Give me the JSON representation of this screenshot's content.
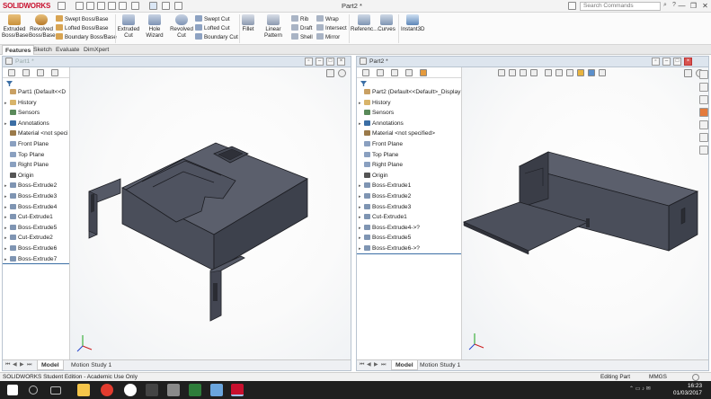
{
  "titlebar": {
    "logo": "SOLIDWORKS",
    "title": "Part2 *",
    "search_placeholder": "Search Commands",
    "search_icon": "search-icon",
    "window_buttons": [
      "—",
      "❐",
      "✕"
    ]
  },
  "ribbon": {
    "extruded_boss": "Extruded Boss/Base",
    "revolved_boss": "Revolved Boss/Base",
    "swept_boss": "Swept Boss/Base",
    "lofted_boss": "Lofted Boss/Base",
    "boundary_boss": "Boundary Boss/Base",
    "extruded_cut": "Extruded Cut",
    "hole_wizard": "Hole Wizard",
    "revolved_cut": "Revolved Cut",
    "swept_cut": "Swept Cut",
    "lofted_cut": "Lofted Cut",
    "boundary_cut": "Boundary Cut",
    "fillet": "Fillet",
    "linear_pattern": "Linear Pattern",
    "rib": "Rib",
    "draft": "Draft",
    "shell": "Shell",
    "wrap": "Wrap",
    "intersect": "Intersect",
    "mirror": "Mirror",
    "reference": "Referenc...",
    "curves": "Curves",
    "instant3d": "Instant3D"
  },
  "command_tabs": [
    "Features",
    "Sketch",
    "Evaluate",
    "DimXpert"
  ],
  "win1": {
    "title": "Part1 *",
    "tree": [
      {
        "label": "Part1  (Default<<D",
        "arrow": "",
        "icon": "part"
      },
      {
        "label": "History",
        "arrow": "▸",
        "icon": "folder"
      },
      {
        "label": "Sensors",
        "arrow": "",
        "icon": "sensor"
      },
      {
        "label": "Annotations",
        "arrow": "▸",
        "icon": "annotation"
      },
      {
        "label": "Material <not speci",
        "arrow": "",
        "icon": "material"
      },
      {
        "label": "Front Plane",
        "arrow": "",
        "icon": "plane"
      },
      {
        "label": "Top Plane",
        "arrow": "",
        "icon": "plane"
      },
      {
        "label": "Right Plane",
        "arrow": "",
        "icon": "plane"
      },
      {
        "label": "Origin",
        "arrow": "",
        "icon": "origin"
      },
      {
        "label": "Boss-Extrude2",
        "arrow": "▸",
        "icon": "feature"
      },
      {
        "label": "Boss-Extrude3",
        "arrow": "▸",
        "icon": "feature"
      },
      {
        "label": "Boss-Extrude4",
        "arrow": "▸",
        "icon": "feature"
      },
      {
        "label": "Cut-Extrude1",
        "arrow": "▸",
        "icon": "feature"
      },
      {
        "label": "Boss-Extrude5",
        "arrow": "▸",
        "icon": "feature"
      },
      {
        "label": "Cut-Extrude2",
        "arrow": "▸",
        "icon": "feature"
      },
      {
        "label": "Boss-Extrude6",
        "arrow": "▸",
        "icon": "feature"
      },
      {
        "label": "Boss-Extrude7",
        "arrow": "▸",
        "icon": "feature"
      }
    ],
    "tabs": [
      "Model",
      "Motion Study 1"
    ]
  },
  "win2": {
    "title": "Part2 *",
    "tree": [
      {
        "label": "Part2  (Default<<Default>_Display S",
        "arrow": "",
        "icon": "part"
      },
      {
        "label": "History",
        "arrow": "▸",
        "icon": "folder"
      },
      {
        "label": "Sensors",
        "arrow": "",
        "icon": "sensor"
      },
      {
        "label": "Annotations",
        "arrow": "▸",
        "icon": "annotation"
      },
      {
        "label": "Material <not specified>",
        "arrow": "",
        "icon": "material"
      },
      {
        "label": "Front Plane",
        "arrow": "",
        "icon": "plane"
      },
      {
        "label": "Top Plane",
        "arrow": "",
        "icon": "plane"
      },
      {
        "label": "Right Plane",
        "arrow": "",
        "icon": "plane"
      },
      {
        "label": "Origin",
        "arrow": "",
        "icon": "origin"
      },
      {
        "label": "Boss-Extrude1",
        "arrow": "▸",
        "icon": "feature"
      },
      {
        "label": "Boss-Extrude2",
        "arrow": "▸",
        "icon": "feature"
      },
      {
        "label": "Boss-Extrude3",
        "arrow": "▸",
        "icon": "feature"
      },
      {
        "label": "Cut-Extrude1",
        "arrow": "▸",
        "icon": "feature"
      },
      {
        "label": "Boss-Extrude4->?",
        "arrow": "▸",
        "icon": "feature"
      },
      {
        "label": "Boss-Extrude5",
        "arrow": "▸",
        "icon": "feature"
      },
      {
        "label": "Boss-Extrude6->?",
        "arrow": "▸",
        "icon": "feature"
      }
    ],
    "tabs": [
      "Model",
      "Motion Study 1"
    ]
  },
  "status": {
    "left": "SOLIDWORKS Student Edition - Academic Use Only",
    "editing": "Editing Part",
    "units": "MMGS"
  },
  "taskbar": {
    "time": "16:23",
    "date": "01/03/2017"
  },
  "colors": {
    "model_face_top": "#5b5f6c",
    "model_face_front": "#4a4e5a",
    "model_face_side": "#3d414c",
    "model_edge": "#1c1d22",
    "brand_red": "#c8102e",
    "accent_blue": "#3b6ea5"
  }
}
